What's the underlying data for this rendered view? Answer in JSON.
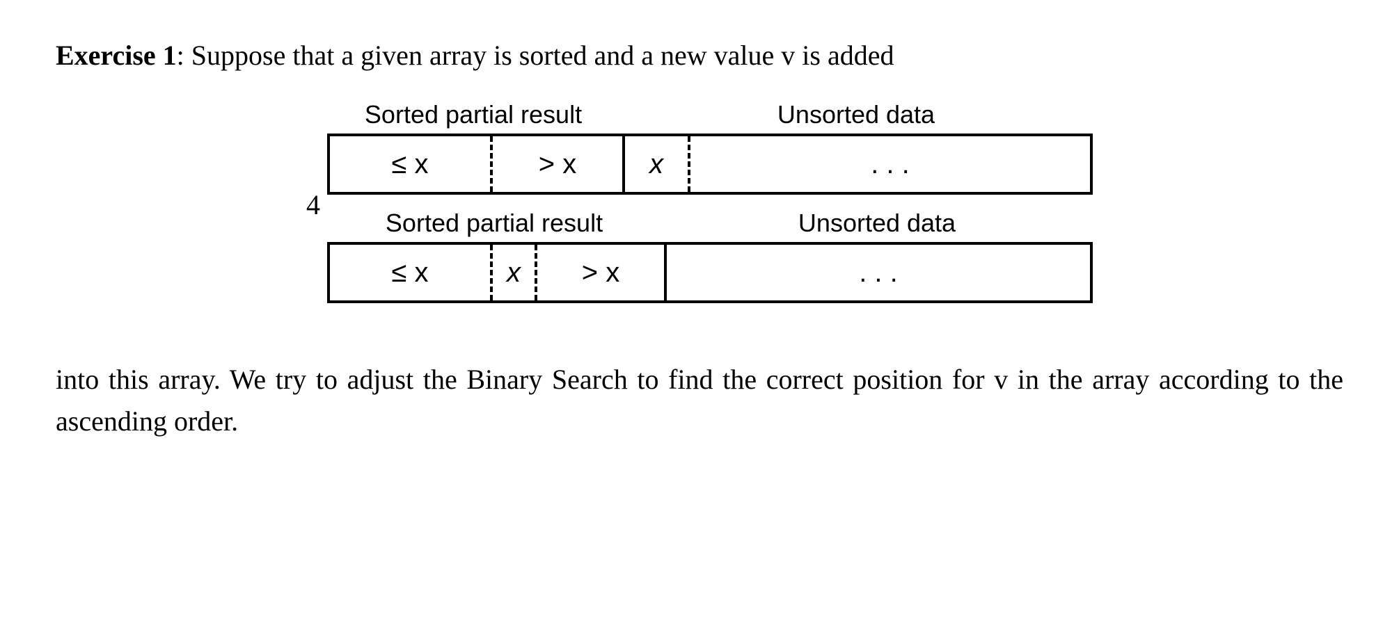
{
  "exercise": {
    "label": "Exercise 1",
    "text_part1": ": Suppose that a given array is sorted and a new value v is added",
    "text_part2": "into this array. We try to adjust the Binary Search to find the correct position for v in the array according to the ascending order."
  },
  "diagram": {
    "side_number": "4",
    "row1": {
      "label_sorted": "Sorted partial result",
      "label_unsorted": "Unsorted data",
      "cells": {
        "le_x": "≤ x",
        "gt_x": "> x",
        "x": "x",
        "rest": ". . ."
      }
    },
    "row2": {
      "label_sorted": "Sorted partial result",
      "label_unsorted": "Unsorted data",
      "cells": {
        "le_x": "≤ x",
        "x": "x",
        "gt_x": "> x",
        "rest": ". . ."
      }
    }
  }
}
